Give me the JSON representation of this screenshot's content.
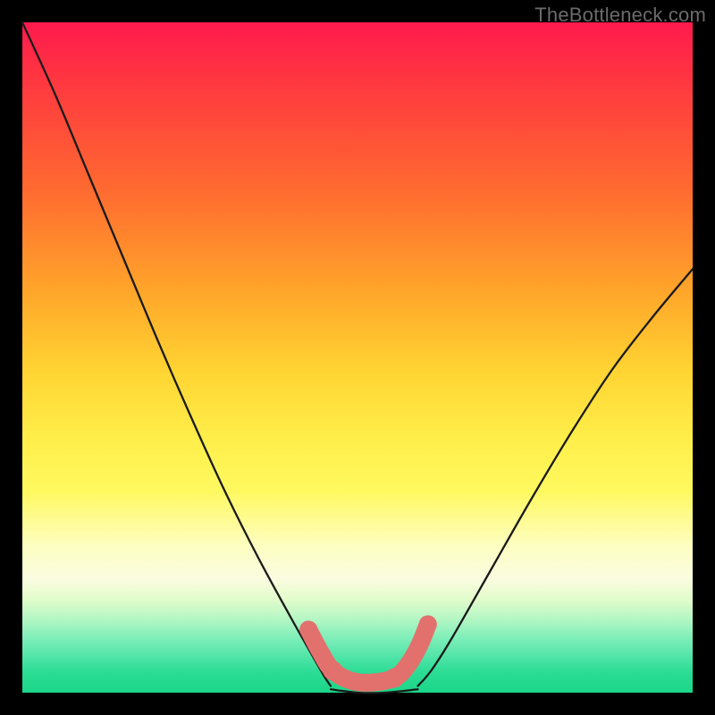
{
  "watermark": "TheBottleneck.com",
  "chart_data": {
    "type": "line",
    "title": "",
    "xlabel": "",
    "ylabel": "",
    "xlim": [
      0,
      1
    ],
    "ylim": [
      0,
      1
    ],
    "series": [
      {
        "name": "curve-left",
        "x": [
          0.0,
          0.05,
          0.1,
          0.15,
          0.2,
          0.25,
          0.3,
          0.35,
          0.4,
          0.43,
          0.45,
          0.46
        ],
        "y": [
          1.0,
          0.89,
          0.77,
          0.65,
          0.53,
          0.415,
          0.305,
          0.205,
          0.113,
          0.06,
          0.025,
          0.01
        ]
      },
      {
        "name": "curve-right",
        "x": [
          0.59,
          0.61,
          0.64,
          0.7,
          0.76,
          0.82,
          0.88,
          0.94,
          1.0
        ],
        "y": [
          0.01,
          0.033,
          0.08,
          0.185,
          0.29,
          0.39,
          0.482,
          0.56,
          0.632
        ]
      },
      {
        "name": "trough-flat",
        "x": [
          0.46,
          0.5,
          0.54,
          0.59
        ],
        "y": [
          0.005,
          0.0,
          0.0,
          0.005
        ]
      },
      {
        "name": "trough-overlay",
        "x": [
          0.427,
          0.445,
          0.463,
          0.49,
          0.52,
          0.555,
          0.575,
          0.592,
          0.605
        ],
        "y": [
          0.094,
          0.06,
          0.033,
          0.018,
          0.015,
          0.022,
          0.041,
          0.07,
          0.102
        ]
      }
    ],
    "colors": {
      "curve": "#1a1a1a",
      "trough_overlay": "#e2716e",
      "trough_dot": "#e2716e"
    }
  }
}
